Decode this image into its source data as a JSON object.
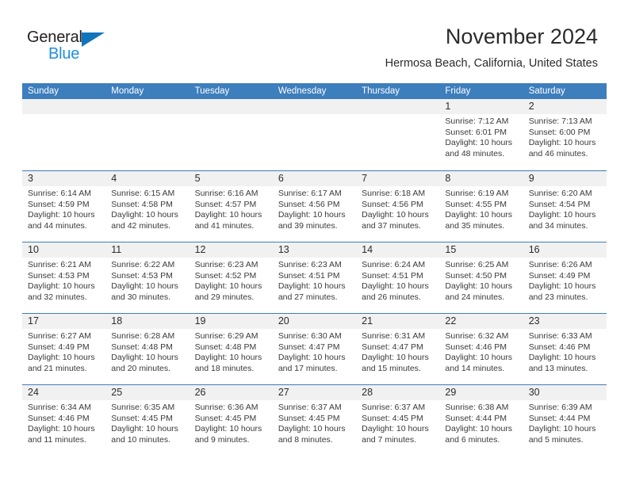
{
  "brand": {
    "logo_text_top": "General",
    "logo_text_bottom": "Blue",
    "logo_icon": "blue-triangle-icon",
    "color_dark": "#231f20",
    "color_blue": "#1f8fe0"
  },
  "header": {
    "month_title": "November 2024",
    "location": "Hermosa Beach, California, United States"
  },
  "theme": {
    "header_blue": "#3d7ebd",
    "daynum_band": "#f1f1f1",
    "text": "#2b2b2b"
  },
  "calendar": {
    "weekday_headers": [
      "Sunday",
      "Monday",
      "Tuesday",
      "Wednesday",
      "Thursday",
      "Friday",
      "Saturday"
    ],
    "weeks": [
      [
        {
          "day": "",
          "sunrise": "",
          "sunset": "",
          "daylight_1": "",
          "daylight_2": ""
        },
        {
          "day": "",
          "sunrise": "",
          "sunset": "",
          "daylight_1": "",
          "daylight_2": ""
        },
        {
          "day": "",
          "sunrise": "",
          "sunset": "",
          "daylight_1": "",
          "daylight_2": ""
        },
        {
          "day": "",
          "sunrise": "",
          "sunset": "",
          "daylight_1": "",
          "daylight_2": ""
        },
        {
          "day": "",
          "sunrise": "",
          "sunset": "",
          "daylight_1": "",
          "daylight_2": ""
        },
        {
          "day": "1",
          "sunrise": "Sunrise: 7:12 AM",
          "sunset": "Sunset: 6:01 PM",
          "daylight_1": "Daylight: 10 hours",
          "daylight_2": "and 48 minutes."
        },
        {
          "day": "2",
          "sunrise": "Sunrise: 7:13 AM",
          "sunset": "Sunset: 6:00 PM",
          "daylight_1": "Daylight: 10 hours",
          "daylight_2": "and 46 minutes."
        }
      ],
      [
        {
          "day": "3",
          "sunrise": "Sunrise: 6:14 AM",
          "sunset": "Sunset: 4:59 PM",
          "daylight_1": "Daylight: 10 hours",
          "daylight_2": "and 44 minutes."
        },
        {
          "day": "4",
          "sunrise": "Sunrise: 6:15 AM",
          "sunset": "Sunset: 4:58 PM",
          "daylight_1": "Daylight: 10 hours",
          "daylight_2": "and 42 minutes."
        },
        {
          "day": "5",
          "sunrise": "Sunrise: 6:16 AM",
          "sunset": "Sunset: 4:57 PM",
          "daylight_1": "Daylight: 10 hours",
          "daylight_2": "and 41 minutes."
        },
        {
          "day": "6",
          "sunrise": "Sunrise: 6:17 AM",
          "sunset": "Sunset: 4:56 PM",
          "daylight_1": "Daylight: 10 hours",
          "daylight_2": "and 39 minutes."
        },
        {
          "day": "7",
          "sunrise": "Sunrise: 6:18 AM",
          "sunset": "Sunset: 4:56 PM",
          "daylight_1": "Daylight: 10 hours",
          "daylight_2": "and 37 minutes."
        },
        {
          "day": "8",
          "sunrise": "Sunrise: 6:19 AM",
          "sunset": "Sunset: 4:55 PM",
          "daylight_1": "Daylight: 10 hours",
          "daylight_2": "and 35 minutes."
        },
        {
          "day": "9",
          "sunrise": "Sunrise: 6:20 AM",
          "sunset": "Sunset: 4:54 PM",
          "daylight_1": "Daylight: 10 hours",
          "daylight_2": "and 34 minutes."
        }
      ],
      [
        {
          "day": "10",
          "sunrise": "Sunrise: 6:21 AM",
          "sunset": "Sunset: 4:53 PM",
          "daylight_1": "Daylight: 10 hours",
          "daylight_2": "and 32 minutes."
        },
        {
          "day": "11",
          "sunrise": "Sunrise: 6:22 AM",
          "sunset": "Sunset: 4:53 PM",
          "daylight_1": "Daylight: 10 hours",
          "daylight_2": "and 30 minutes."
        },
        {
          "day": "12",
          "sunrise": "Sunrise: 6:23 AM",
          "sunset": "Sunset: 4:52 PM",
          "daylight_1": "Daylight: 10 hours",
          "daylight_2": "and 29 minutes."
        },
        {
          "day": "13",
          "sunrise": "Sunrise: 6:23 AM",
          "sunset": "Sunset: 4:51 PM",
          "daylight_1": "Daylight: 10 hours",
          "daylight_2": "and 27 minutes."
        },
        {
          "day": "14",
          "sunrise": "Sunrise: 6:24 AM",
          "sunset": "Sunset: 4:51 PM",
          "daylight_1": "Daylight: 10 hours",
          "daylight_2": "and 26 minutes."
        },
        {
          "day": "15",
          "sunrise": "Sunrise: 6:25 AM",
          "sunset": "Sunset: 4:50 PM",
          "daylight_1": "Daylight: 10 hours",
          "daylight_2": "and 24 minutes."
        },
        {
          "day": "16",
          "sunrise": "Sunrise: 6:26 AM",
          "sunset": "Sunset: 4:49 PM",
          "daylight_1": "Daylight: 10 hours",
          "daylight_2": "and 23 minutes."
        }
      ],
      [
        {
          "day": "17",
          "sunrise": "Sunrise: 6:27 AM",
          "sunset": "Sunset: 4:49 PM",
          "daylight_1": "Daylight: 10 hours",
          "daylight_2": "and 21 minutes."
        },
        {
          "day": "18",
          "sunrise": "Sunrise: 6:28 AM",
          "sunset": "Sunset: 4:48 PM",
          "daylight_1": "Daylight: 10 hours",
          "daylight_2": "and 20 minutes."
        },
        {
          "day": "19",
          "sunrise": "Sunrise: 6:29 AM",
          "sunset": "Sunset: 4:48 PM",
          "daylight_1": "Daylight: 10 hours",
          "daylight_2": "and 18 minutes."
        },
        {
          "day": "20",
          "sunrise": "Sunrise: 6:30 AM",
          "sunset": "Sunset: 4:47 PM",
          "daylight_1": "Daylight: 10 hours",
          "daylight_2": "and 17 minutes."
        },
        {
          "day": "21",
          "sunrise": "Sunrise: 6:31 AM",
          "sunset": "Sunset: 4:47 PM",
          "daylight_1": "Daylight: 10 hours",
          "daylight_2": "and 15 minutes."
        },
        {
          "day": "22",
          "sunrise": "Sunrise: 6:32 AM",
          "sunset": "Sunset: 4:46 PM",
          "daylight_1": "Daylight: 10 hours",
          "daylight_2": "and 14 minutes."
        },
        {
          "day": "23",
          "sunrise": "Sunrise: 6:33 AM",
          "sunset": "Sunset: 4:46 PM",
          "daylight_1": "Daylight: 10 hours",
          "daylight_2": "and 13 minutes."
        }
      ],
      [
        {
          "day": "24",
          "sunrise": "Sunrise: 6:34 AM",
          "sunset": "Sunset: 4:46 PM",
          "daylight_1": "Daylight: 10 hours",
          "daylight_2": "and 11 minutes."
        },
        {
          "day": "25",
          "sunrise": "Sunrise: 6:35 AM",
          "sunset": "Sunset: 4:45 PM",
          "daylight_1": "Daylight: 10 hours",
          "daylight_2": "and 10 minutes."
        },
        {
          "day": "26",
          "sunrise": "Sunrise: 6:36 AM",
          "sunset": "Sunset: 4:45 PM",
          "daylight_1": "Daylight: 10 hours",
          "daylight_2": "and 9 minutes."
        },
        {
          "day": "27",
          "sunrise": "Sunrise: 6:37 AM",
          "sunset": "Sunset: 4:45 PM",
          "daylight_1": "Daylight: 10 hours",
          "daylight_2": "and 8 minutes."
        },
        {
          "day": "28",
          "sunrise": "Sunrise: 6:37 AM",
          "sunset": "Sunset: 4:45 PM",
          "daylight_1": "Daylight: 10 hours",
          "daylight_2": "and 7 minutes."
        },
        {
          "day": "29",
          "sunrise": "Sunrise: 6:38 AM",
          "sunset": "Sunset: 4:44 PM",
          "daylight_1": "Daylight: 10 hours",
          "daylight_2": "and 6 minutes."
        },
        {
          "day": "30",
          "sunrise": "Sunrise: 6:39 AM",
          "sunset": "Sunset: 4:44 PM",
          "daylight_1": "Daylight: 10 hours",
          "daylight_2": "and 5 minutes."
        }
      ]
    ]
  }
}
